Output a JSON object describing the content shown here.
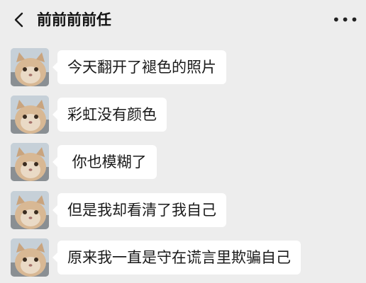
{
  "header": {
    "title": "前前前前任",
    "back_icon": "chevron-left-icon",
    "more_icon": "more-dots-icon",
    "more_glyph": "•••"
  },
  "messages": [
    {
      "text": "今天翻开了褪色的照片"
    },
    {
      "text": "彩虹没有颜色"
    },
    {
      "text": " 你也模糊了"
    },
    {
      "text": "但是我却看清了我自己"
    },
    {
      "text": "原来我一直是守在谎言里欺骗自己"
    }
  ],
  "colors": {
    "background": "#ededed",
    "bubble": "#ffffff",
    "text": "#1a1a1a"
  }
}
